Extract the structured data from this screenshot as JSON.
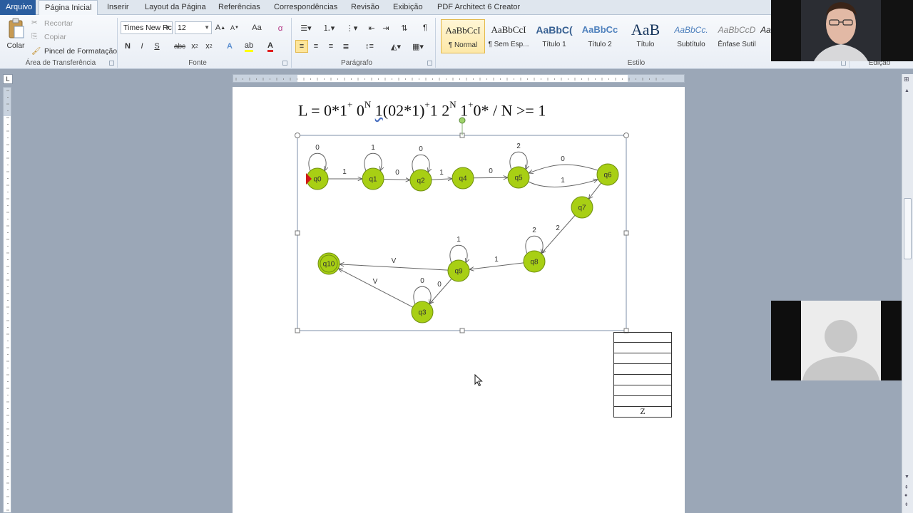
{
  "tabs": [
    "Arquivo",
    "Página Inicial",
    "Inserir",
    "Layout da Página",
    "Referências",
    "Correspondências",
    "Revisão",
    "Exibição",
    "PDF Architect 6 Creator"
  ],
  "ribbon": {
    "clipboard": {
      "paste": "Colar",
      "cut": "Recortar",
      "copy": "Copiar",
      "format_painter": "Pincel de Formatação",
      "label": "Área de Transferência"
    },
    "font": {
      "name": "Times New Rc",
      "size": "12",
      "label": "Fonte",
      "bold": "N",
      "italic": "I",
      "underline": "S",
      "strike": "abc",
      "change_case": "Aa"
    },
    "paragraph": {
      "label": "Parágrafo",
      "pilcrow": "¶"
    },
    "styles": {
      "label": "Estilo",
      "items": [
        {
          "preview": "AaBbCcI",
          "name": "¶ Normal"
        },
        {
          "preview": "AaBbCcI",
          "name": "¶ Sem Esp..."
        },
        {
          "preview": "AaBbC(",
          "name": "Título 1"
        },
        {
          "preview": "AaBbCc",
          "name": "Título 2"
        },
        {
          "preview": "AaB",
          "name": "Título"
        },
        {
          "preview": "AaBbCc.",
          "name": "Subtítulo"
        },
        {
          "preview": "AaBbCcD",
          "name": "Ênfase Sutil"
        },
        {
          "preview": "Aa",
          "name": ""
        }
      ]
    },
    "editing": {
      "label": "Edição"
    }
  },
  "document": {
    "formula": {
      "p1": "L = 0*1",
      "s1": "+",
      "p2": " 0",
      "s2": "N",
      "p3": " ",
      "p3b": "1",
      "p3c": "(02*1)",
      "s3": "+",
      "p4": "1 2",
      "s4": "N",
      "p5": " 1",
      "s5": "+",
      "p6": "0* / N >= 1"
    },
    "automaton": {
      "states": [
        {
          "id": "q0",
          "initial": true
        },
        {
          "id": "q1"
        },
        {
          "id": "q2"
        },
        {
          "id": "q4"
        },
        {
          "id": "q5"
        },
        {
          "id": "q6"
        },
        {
          "id": "q7"
        },
        {
          "id": "q8"
        },
        {
          "id": "q9"
        },
        {
          "id": "q3"
        },
        {
          "id": "q10",
          "final": true
        }
      ],
      "transitions": [
        {
          "from": "q0",
          "to": "q0",
          "label": "0"
        },
        {
          "from": "q0",
          "to": "q1",
          "label": "1"
        },
        {
          "from": "q1",
          "to": "q1",
          "label": "1"
        },
        {
          "from": "q1",
          "to": "q2",
          "label": "0"
        },
        {
          "from": "q2",
          "to": "q2",
          "label": "0"
        },
        {
          "from": "q2",
          "to": "q4",
          "label": "1"
        },
        {
          "from": "q4",
          "to": "q5",
          "label": "0"
        },
        {
          "from": "q5",
          "to": "q5",
          "label": "2"
        },
        {
          "from": "q6",
          "to": "q5",
          "label": "0"
        },
        {
          "from": "q5",
          "to": "q6",
          "label": "1"
        },
        {
          "from": "q6",
          "to": "q7",
          "label": ""
        },
        {
          "from": "q7",
          "to": "q8",
          "label": "2"
        },
        {
          "from": "q8",
          "to": "q8",
          "label": "2"
        },
        {
          "from": "q8",
          "to": "q9",
          "label": "1"
        },
        {
          "from": "q9",
          "to": "q9",
          "label": "1"
        },
        {
          "from": "q9",
          "to": "q10",
          "label": "V"
        },
        {
          "from": "q9",
          "to": "q3",
          "label": "0"
        },
        {
          "from": "q3",
          "to": "q3",
          "label": "0"
        },
        {
          "from": "q3",
          "to": "q10",
          "label": "V"
        }
      ]
    },
    "stack": {
      "cells": [
        "",
        "",
        "",
        "",
        "",
        "",
        "",
        "Z"
      ]
    }
  },
  "colors": {
    "state_fill": "#a8cf14",
    "state_stroke": "#6f8f10",
    "initial_marker": "#d01818",
    "file_tab": "#2a5d9f"
  }
}
